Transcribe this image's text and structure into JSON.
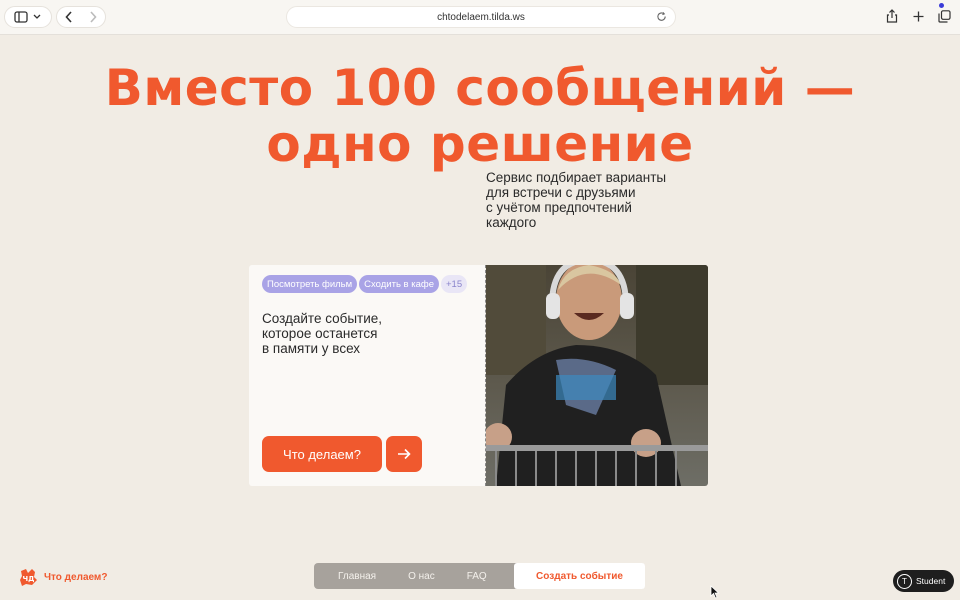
{
  "browser": {
    "url": "chtodelaem.tilda.ws"
  },
  "hero": {
    "headline_line1": "Вместо 100 сообщений —",
    "headline_line2": "одно решение",
    "subtitle": "Сервис подбирает варианты\nдля встречи с друзьями\nс учётом предпочтений\nкаждого"
  },
  "card": {
    "tags": [
      "Посмотреть фильм",
      "Сходить в кафе"
    ],
    "more_tag": "+15",
    "text": "Создайте событие,\nкоторое останется\nв памяти у всех",
    "cta_label": "Что делаем?"
  },
  "footer": {
    "logo_text": "Что делаем?",
    "nav": [
      "Главная",
      "О нас",
      "FAQ"
    ],
    "create_label": "Создать событие"
  },
  "badge": {
    "label": "Student"
  },
  "colors": {
    "accent": "#f0592e",
    "background": "#f1ece4",
    "tag": "#a9a3e6"
  }
}
